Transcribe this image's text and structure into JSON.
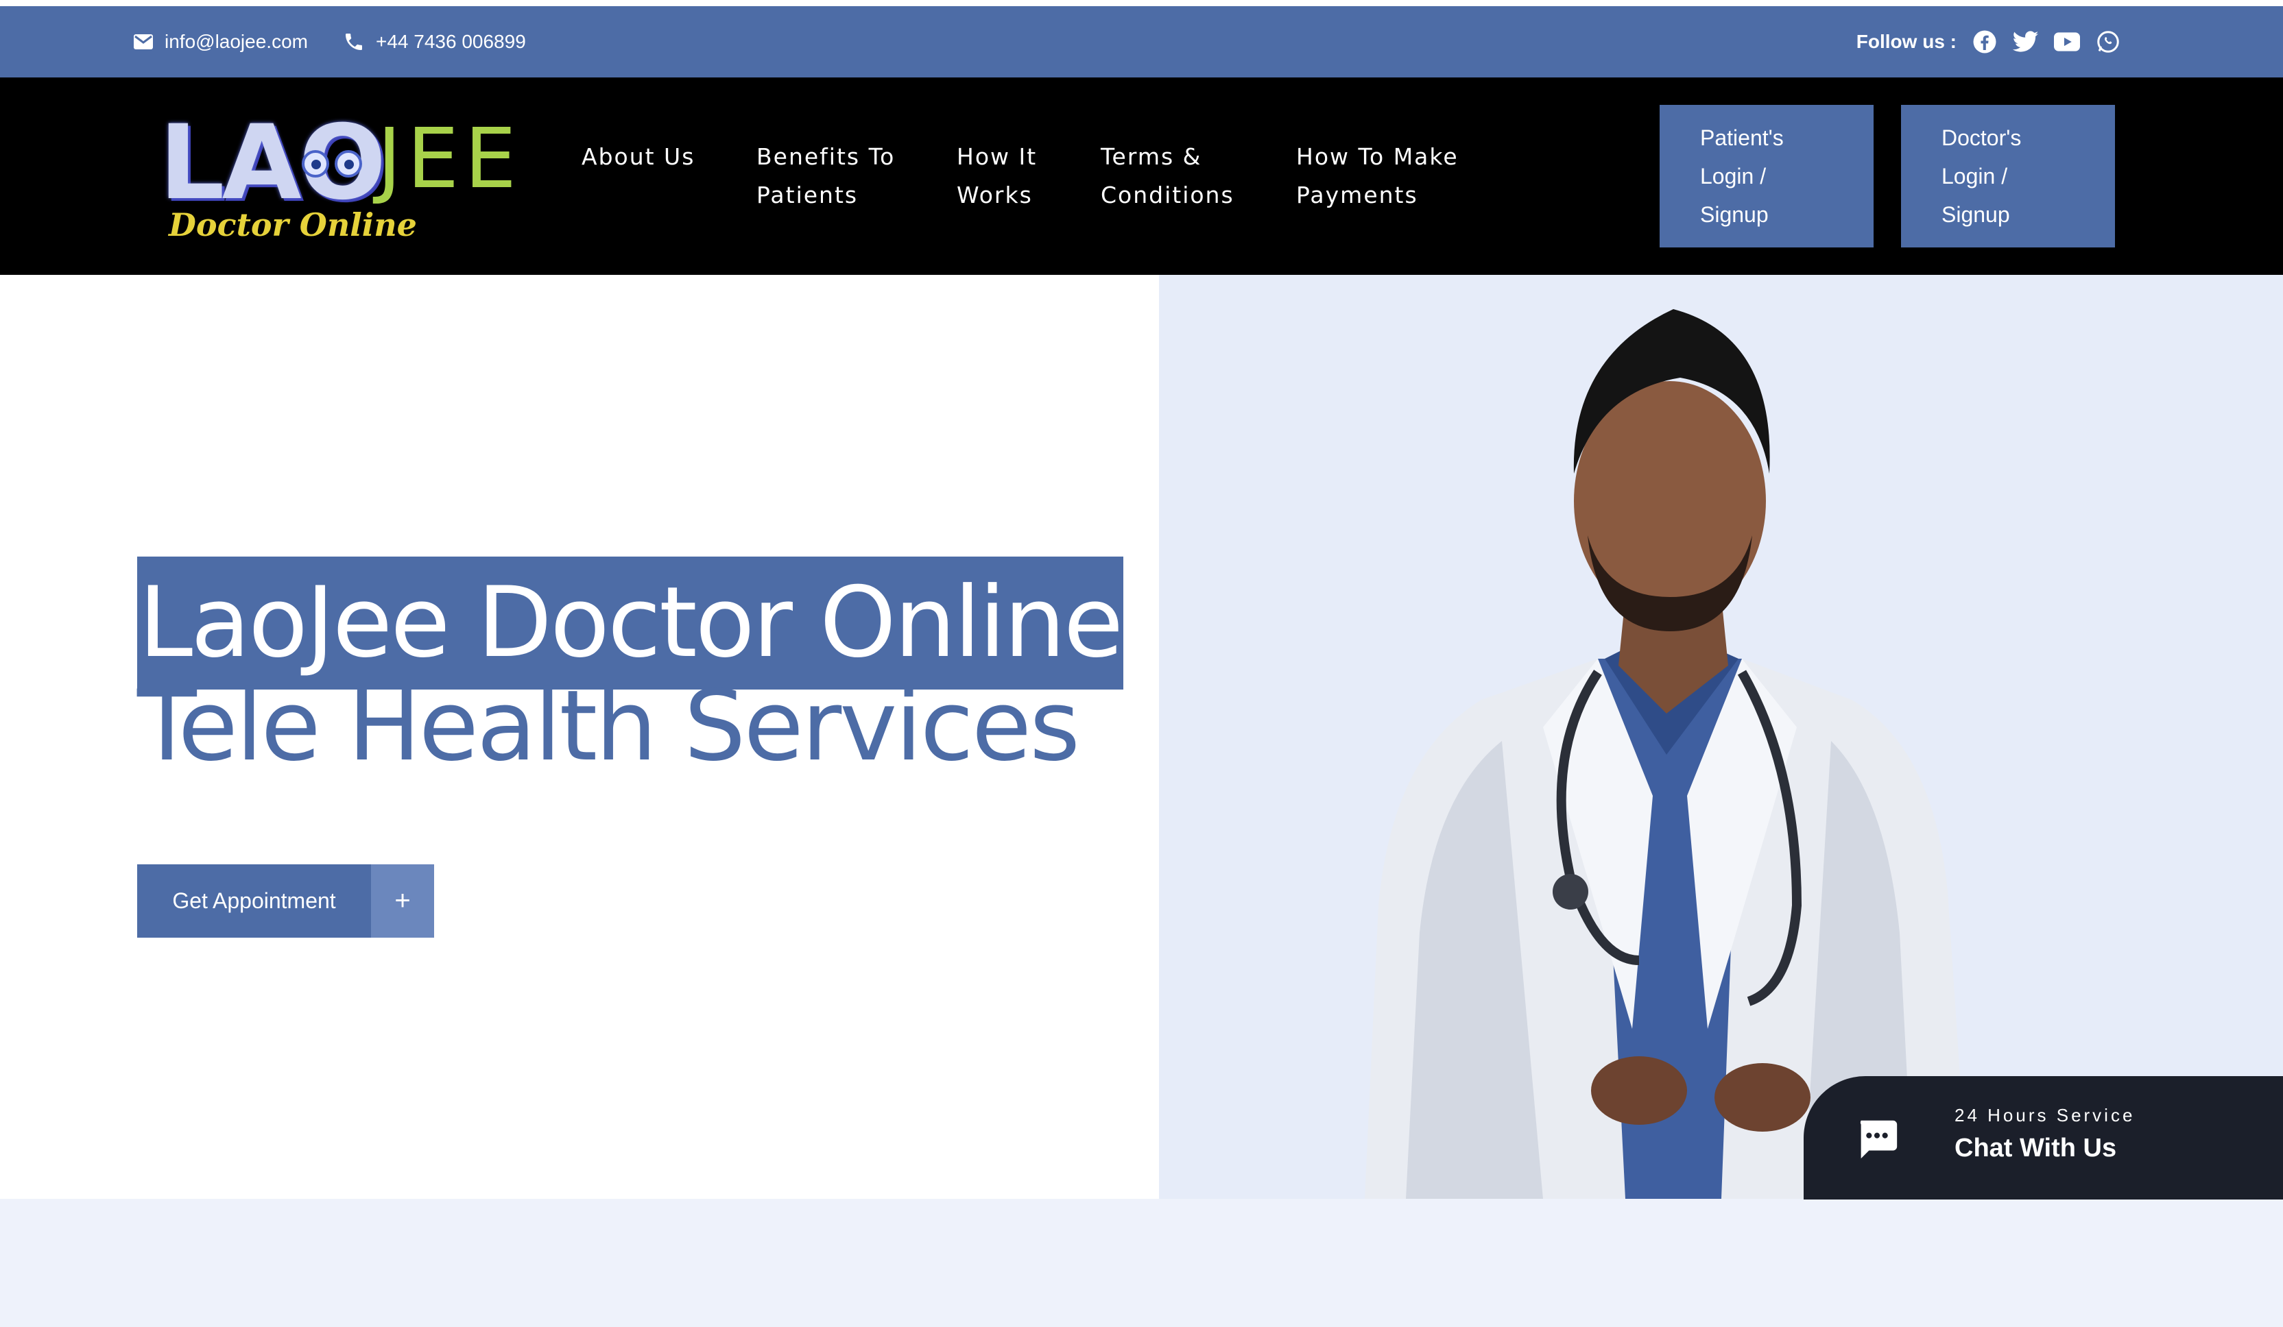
{
  "topbar": {
    "email": "info@laojee.com",
    "phone": "+44 7436 006899",
    "follow_label": "Follow us :",
    "social_icons": [
      "facebook-icon",
      "twitter-icon",
      "youtube-icon",
      "whatsapp-icon"
    ]
  },
  "logo": {
    "brand_part1": "LAO",
    "brand_part2": "JEE",
    "tagline": "Doctor Online"
  },
  "nav": {
    "items": [
      {
        "line1": "About Us",
        "line2": ""
      },
      {
        "line1": "Benefits To",
        "line2": "Patients"
      },
      {
        "line1": "How It",
        "line2": "Works"
      },
      {
        "line1": "Terms &",
        "line2": "Conditions"
      },
      {
        "line1": "How To Make",
        "line2": "Payments"
      }
    ]
  },
  "auth": {
    "patient": {
      "line1": "Patient's",
      "line2": "Login /",
      "line3": "Signup"
    },
    "doctor": {
      "line1": "Doctor's",
      "line2": "Login /",
      "line3": "Signup"
    }
  },
  "hero": {
    "title_highlight": "LaoJee Doctor Online",
    "title_sub": "Tele Health Services",
    "cta_label": "Get Appointment",
    "cta_plus": "+"
  },
  "chat": {
    "subtitle": "24 Hours Service",
    "title": "Chat With Us"
  },
  "colors": {
    "brand_blue": "#4d6ca6",
    "nav_black": "#000000",
    "hero_right_bg": "#e6ecf9",
    "chat_bg": "#1b1f2a"
  }
}
